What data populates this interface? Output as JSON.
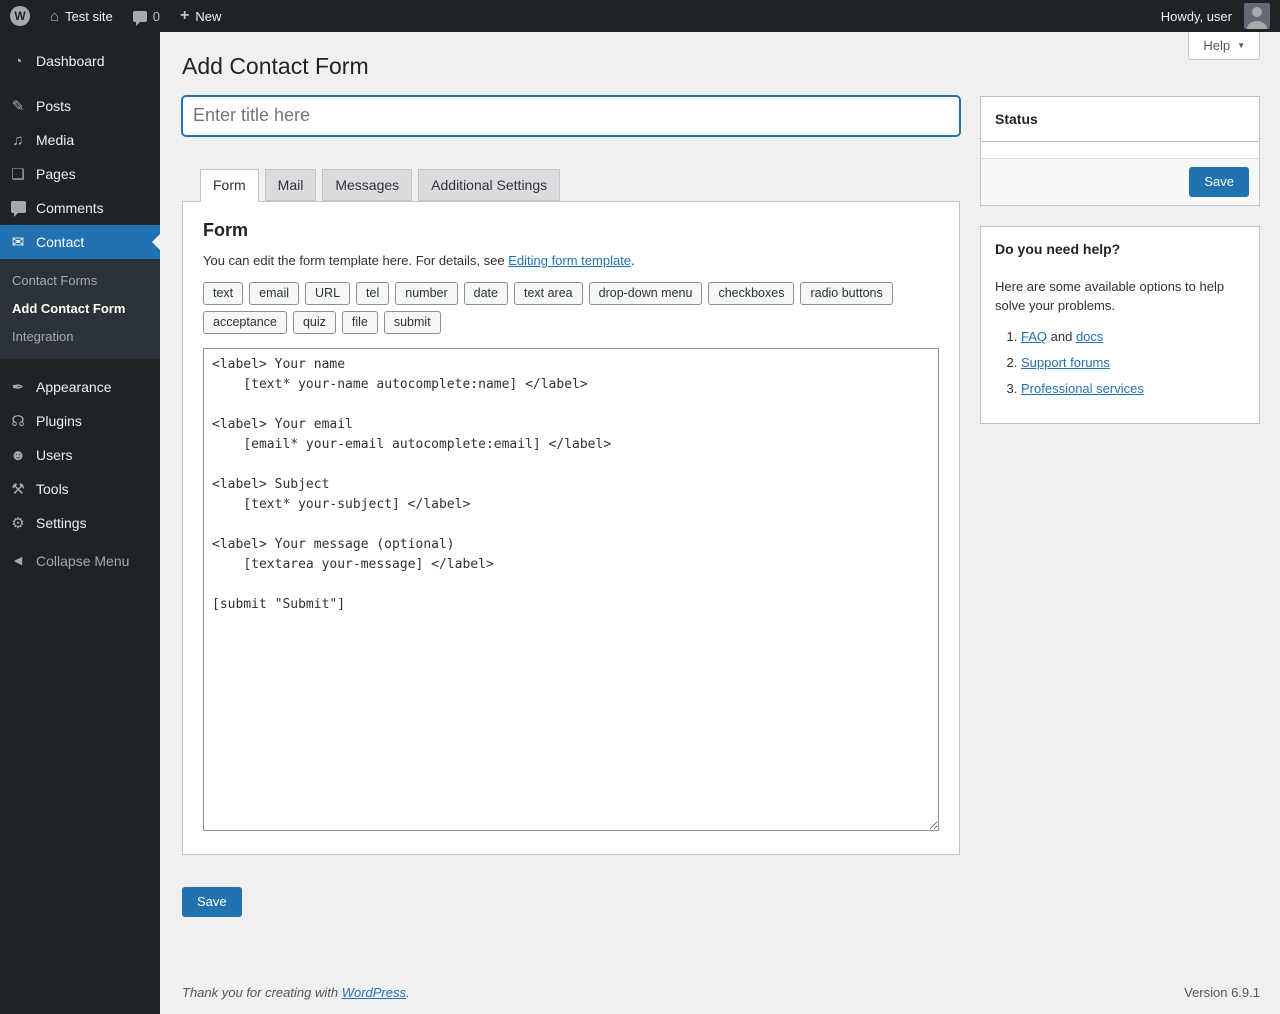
{
  "colors": {
    "accent": "#2271b1",
    "admin_bar_bg": "#1d2327",
    "content_bg": "#f0f0f1",
    "submenu_bg": "#2c3338"
  },
  "admin_bar": {
    "logo_glyph": "W",
    "home_glyph": "⌂",
    "site_name": "Test site",
    "comment_count": "0",
    "plus_glyph": "+",
    "new_label": "New",
    "howdy_text": "Howdy, user"
  },
  "sidebar": {
    "items": [
      {
        "label": "Dashboard",
        "glyph": "◔"
      },
      {
        "label": "Posts",
        "glyph": "✎"
      },
      {
        "label": "Media",
        "glyph": "♫"
      },
      {
        "label": "Pages",
        "glyph": "❏"
      },
      {
        "label": "Comments",
        "glyph": ""
      },
      {
        "label": "Contact",
        "glyph": "✉"
      },
      {
        "label": "Appearance",
        "glyph": "✒"
      },
      {
        "label": "Plugins",
        "glyph": "☊"
      },
      {
        "label": "Users",
        "glyph": "☻"
      },
      {
        "label": "Tools",
        "glyph": "⚒"
      },
      {
        "label": "Settings",
        "glyph": "⚙"
      }
    ],
    "submenu": [
      {
        "label": "Contact Forms"
      },
      {
        "label": "Add Contact Form"
      },
      {
        "label": "Integration"
      }
    ],
    "collapse_label": "Collapse Menu",
    "collapse_glyph": "◀"
  },
  "page": {
    "heading": "Add Contact Form",
    "title_placeholder": "Enter title here",
    "help_label": "Help",
    "help_chevron": "▼"
  },
  "tabs": [
    {
      "label": "Form"
    },
    {
      "label": "Mail"
    },
    {
      "label": "Messages"
    },
    {
      "label": "Additional Settings"
    }
  ],
  "form_panel": {
    "heading": "Form",
    "description_before": "You can edit the form template here. For details, see ",
    "description_link": "Editing form template",
    "description_after": ".",
    "tag_buttons": [
      "text",
      "email",
      "URL",
      "tel",
      "number",
      "date",
      "text area",
      "drop-down menu",
      "checkboxes",
      "radio buttons",
      "acceptance",
      "quiz",
      "file",
      "submit"
    ],
    "template": "<label> Your name\n    [text* your-name autocomplete:name] </label>\n\n<label> Your email\n    [email* your-email autocomplete:email] </label>\n\n<label> Subject\n    [text* your-subject] </label>\n\n<label> Your message (optional)\n    [textarea your-message] </label>\n\n[submit \"Submit\"]",
    "save_label": "Save"
  },
  "status_box": {
    "title": "Status",
    "save_label": "Save"
  },
  "help_box": {
    "title": "Do you need help?",
    "intro": "Here are some available options to help solve your problems.",
    "items": [
      {
        "link1": "FAQ",
        "middle": " and ",
        "link2": "docs"
      },
      {
        "link1": "Support forums"
      },
      {
        "link1": "Professional services"
      }
    ]
  },
  "footer": {
    "thanks_before": "Thank you for creating with ",
    "thanks_link": "WordPress",
    "thanks_after": ".",
    "version": "Version 6.9.1"
  }
}
